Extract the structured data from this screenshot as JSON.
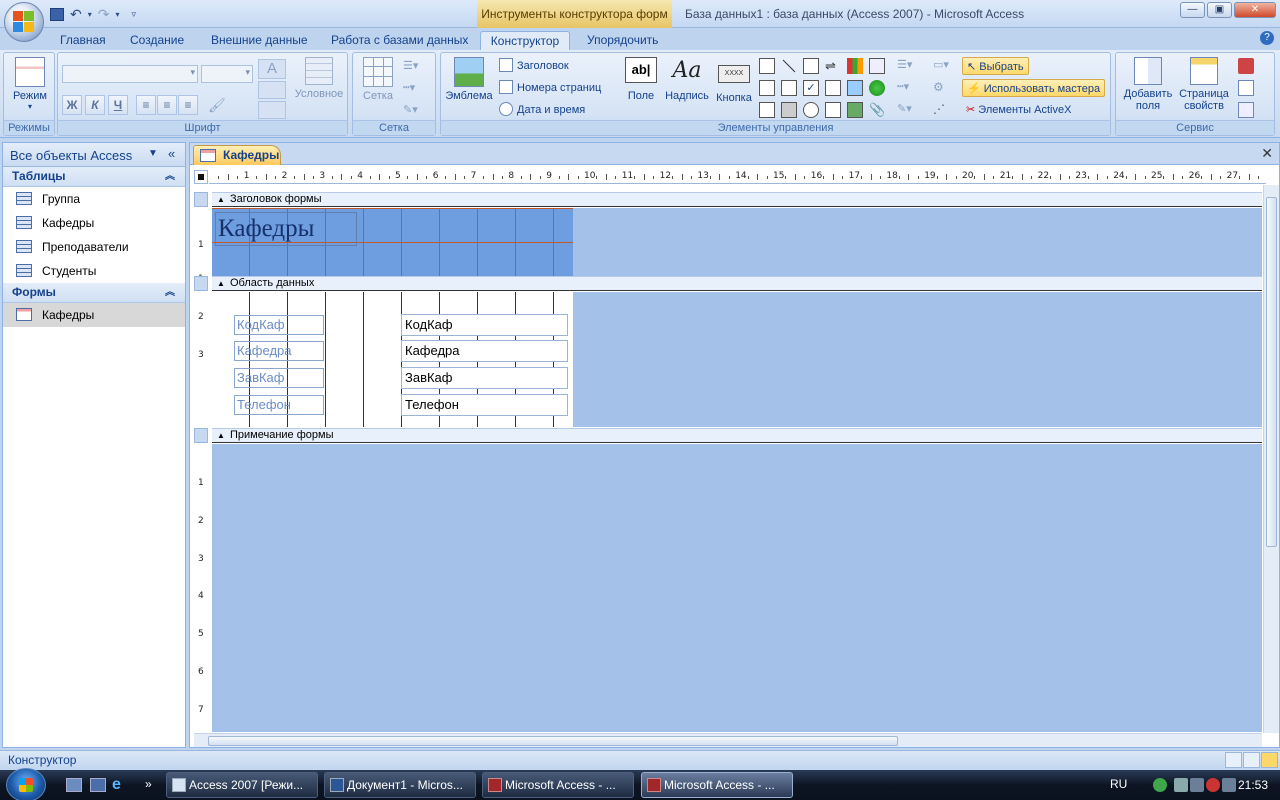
{
  "window": {
    "contextual_title": "Инструменты конструктора форм",
    "title": "База данных1 : база данных (Access 2007) - Microsoft Access"
  },
  "ribbon_tabs": [
    "Главная",
    "Создание",
    "Внешние данные",
    "Работа с базами данных",
    "Конструктор",
    "Упорядочить"
  ],
  "ribbon": {
    "groups": {
      "views": "Режимы",
      "font": "Шрифт",
      "grid": "Сетка",
      "controls": "Элементы управления",
      "tools": "Сервис"
    },
    "views_button": "Режим",
    "conditional": "Условное",
    "grid_button": "Сетка",
    "logo_button": "Эмблема",
    "title_btn": "Заголовок",
    "page_numbers": "Номера страниц",
    "date_time": "Дата и время",
    "field_btn": "Поле",
    "label_btn": "Надпись",
    "button_btn": "Кнопка",
    "button_icon_text": "XXXX",
    "textbox_icon_text": "ab|",
    "label_icon_text": "Aa",
    "select_btn": "Выбрать",
    "use_wizards": "Использовать мастера",
    "activex": "Элементы ActiveX",
    "add_fields": "Добавить поля",
    "add_fields_line1": "Добавить",
    "add_fields_line2": "поля",
    "property_sheet_line1": "Страница",
    "property_sheet_line2": "свойств",
    "bold": "Ж",
    "italic": "К",
    "underline": "Ч"
  },
  "nav": {
    "header": "Все объекты Access",
    "groups": [
      {
        "label": "Таблицы",
        "items": [
          "Группа",
          "Кафедры",
          "Преподаватели",
          "Студенты"
        ]
      },
      {
        "label": "Формы",
        "items": [
          "Кафедры"
        ]
      }
    ]
  },
  "document": {
    "tab": "Кафедры",
    "ruler_numbers": [
      "1",
      "2",
      "3",
      "4",
      "5",
      "6",
      "7",
      "8",
      "9",
      "10",
      "11",
      "12",
      "13",
      "14",
      "15",
      "16",
      "17",
      "18",
      "19",
      "20",
      "21",
      "22",
      "23",
      "24",
      "25",
      "26",
      "27"
    ],
    "left_ruler_header": [
      "1"
    ],
    "left_ruler_detail": [
      "1",
      "2",
      "3"
    ],
    "left_ruler_footer": [
      "1",
      "2",
      "3",
      "4",
      "5",
      "6",
      "7"
    ],
    "sections": {
      "header": "Заголовок формы",
      "detail": "Область данных",
      "footer": "Примечание формы"
    },
    "form_title": "Кафедры",
    "controls": [
      {
        "label": "КодКаф",
        "field": "КодКаф"
      },
      {
        "label": "Кафедра",
        "field": "Кафедра"
      },
      {
        "label": "ЗавКаф",
        "field": "ЗавКаф"
      },
      {
        "label": "Телефон",
        "field": "Телефон"
      }
    ]
  },
  "status": {
    "text": "Конструктор"
  },
  "taskbar": {
    "items": [
      "Access 2007 [Режи...",
      "Документ1 - Micros...",
      "Microsoft Access - ...",
      "Microsoft Access - ..."
    ],
    "active_index": 3,
    "lang": "RU",
    "time": "21:53"
  }
}
